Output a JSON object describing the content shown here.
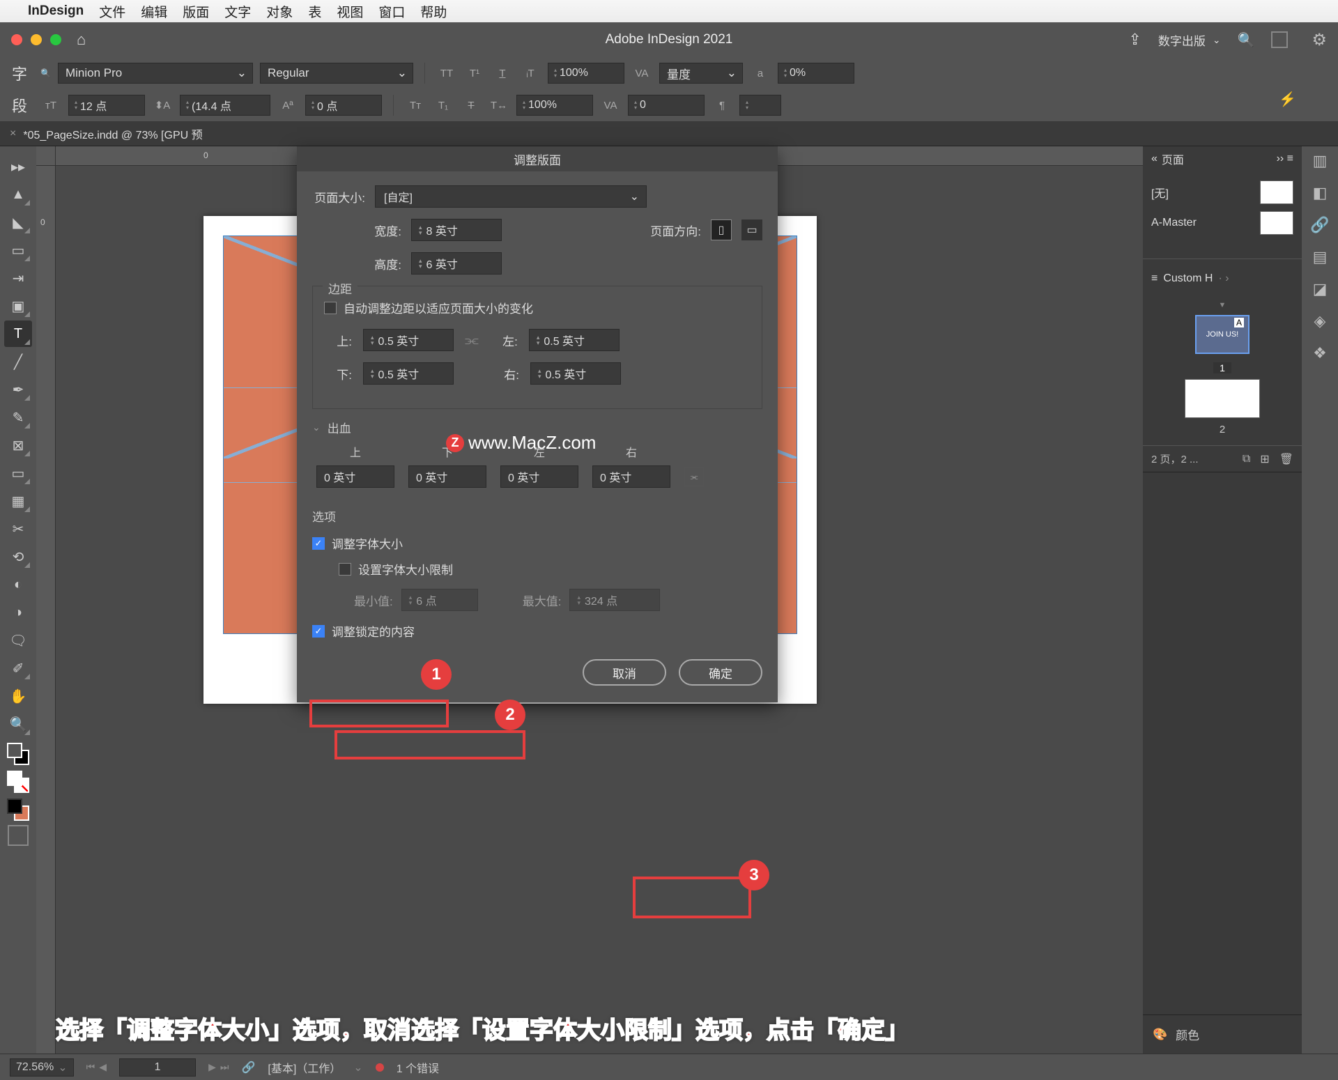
{
  "mac_menu": {
    "app": "InDesign",
    "items": [
      "文件",
      "编辑",
      "版面",
      "文字",
      "对象",
      "表",
      "视图",
      "窗口",
      "帮助"
    ]
  },
  "titlebar": {
    "title": "Adobe InDesign 2021",
    "workspace": "数字出版"
  },
  "control": {
    "char_label": "字",
    "para_label": "段",
    "font": "Minion Pro",
    "style": "Regular",
    "size_label": "12 点",
    "leading": "(14.4 点",
    "baseline": "0 点",
    "scale1": "100%",
    "scale2": "100%",
    "tracking": "量度",
    "kerning": "0%",
    "kerning2": "0"
  },
  "doc_tab": "*05_PageSize.indd @ 73% [GPU 预",
  "dialog": {
    "title": "调整版面",
    "page_size_label": "页面大小:",
    "page_size_value": "[自定]",
    "width_label": "宽度:",
    "width_value": "8 英寸",
    "height_label": "高度:",
    "height_value": "6 英寸",
    "orient_label": "页面方向:",
    "margins_title": "边距",
    "auto_margin_label": "自动调整边距以适应页面大小的变化",
    "top_label": "上:",
    "top_value": "0.5 英寸",
    "bottom_label": "下:",
    "bottom_value": "0.5 英寸",
    "left_label": "左:",
    "left_value": "0.5 英寸",
    "right_label": "右:",
    "right_value": "0.5 英寸",
    "bleed_title": "出血",
    "bleed_headers": [
      "上",
      "下",
      "左",
      "右"
    ],
    "bleed_values": [
      "0 英寸",
      "0 英寸",
      "0 英寸",
      "0 英寸"
    ],
    "options_title": "选项",
    "adjust_font": "调整字体大小",
    "font_limit": "设置字体大小限制",
    "min_label": "最小值:",
    "min_value": "6 点",
    "max_label": "最大值:",
    "max_value": "324 点",
    "adjust_locked": "调整锁定的内容",
    "cancel": "取消",
    "ok": "确定"
  },
  "badges": [
    "1",
    "2",
    "3"
  ],
  "pages_panel": {
    "title": "页面",
    "none": "[无]",
    "master": "A-Master",
    "preset": "Custom H",
    "thumb1_text": "JOIN US!",
    "page1": "1",
    "page2": "2",
    "footer": "2 页，2 ..."
  },
  "color_panel": "颜色",
  "status": {
    "zoom": "72.56%",
    "page": "1",
    "work": "[基本]（工作）",
    "errors": "1 个错误"
  },
  "instruction": "选择「调整字体大小」选项，取消选择「设置字体大小限制」选项，点击「确定」",
  "watermark": "www.MacZ.com",
  "ruler_h_ticks": [
    "0"
  ],
  "ruler_v_ticks": [
    "0"
  ]
}
